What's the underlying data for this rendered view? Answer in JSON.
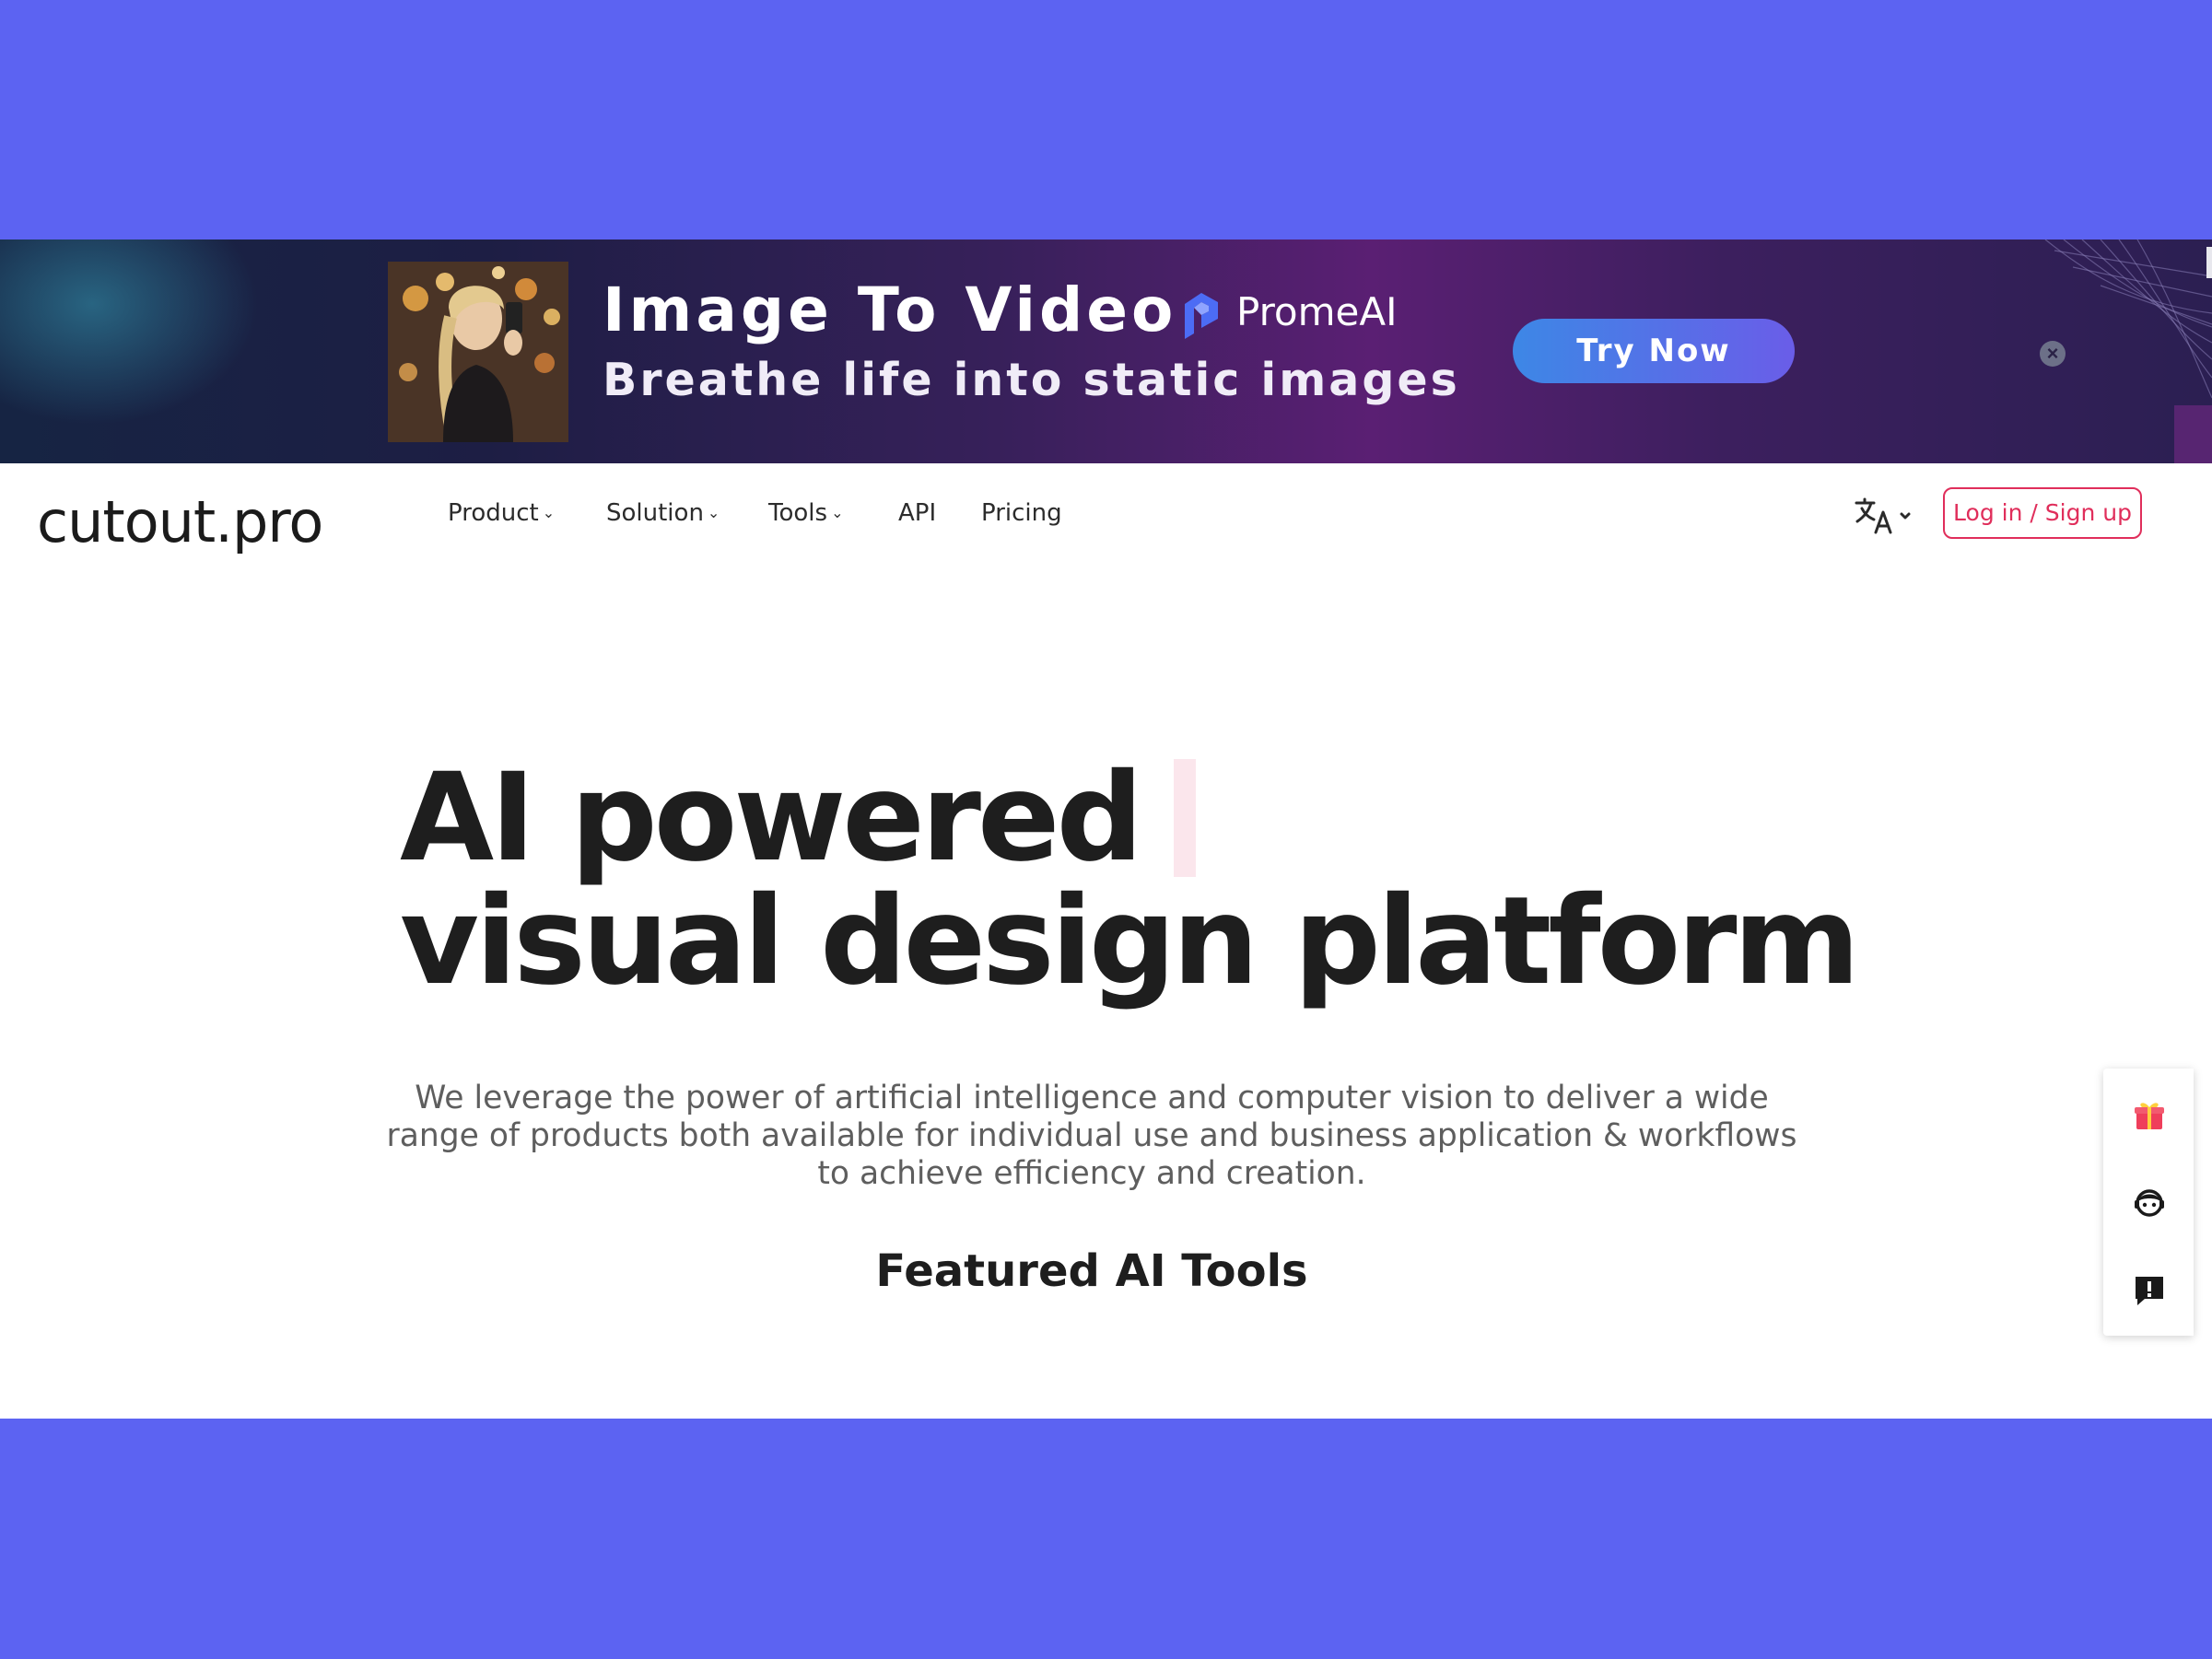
{
  "promo_banner": {
    "title": "Image To Video",
    "subtitle": "Breathe life into static images",
    "partner_name": "PromeAI",
    "cta_label": "Try Now",
    "close_icon": "close-icon",
    "gradient_colors": [
      "#162443",
      "#37205a",
      "#5a1f73",
      "#2b1f52"
    ]
  },
  "nav": {
    "logo_text": "cutout.pro",
    "items": [
      {
        "label": "Product",
        "has_dropdown": true
      },
      {
        "label": "Solution",
        "has_dropdown": true
      },
      {
        "label": "Tools",
        "has_dropdown": true
      },
      {
        "label": "API",
        "has_dropdown": false
      },
      {
        "label": "Pricing",
        "has_dropdown": false
      }
    ],
    "language_icon": "translate-icon",
    "login_label": "Log in / Sign up"
  },
  "hero": {
    "title_line1": "AI powered",
    "title_line2": "visual design platform",
    "description": "We leverage the power of artificial intelligence and computer vision to deliver a wide range of products both available for individual use and business application & workflows to achieve efficiency and creation."
  },
  "featured": {
    "title": "Featured AI Tools"
  },
  "side_panel": {
    "icons": [
      "gift-icon",
      "support-agent-icon",
      "feedback-icon"
    ]
  },
  "colors": {
    "page_frame": "#5c63f2",
    "accent": "#e02e5b",
    "cta_start": "#3d87e6",
    "cta_end": "#6a5de8",
    "text_dark": "#1e1e1e",
    "text_muted": "#5e5e5e"
  }
}
